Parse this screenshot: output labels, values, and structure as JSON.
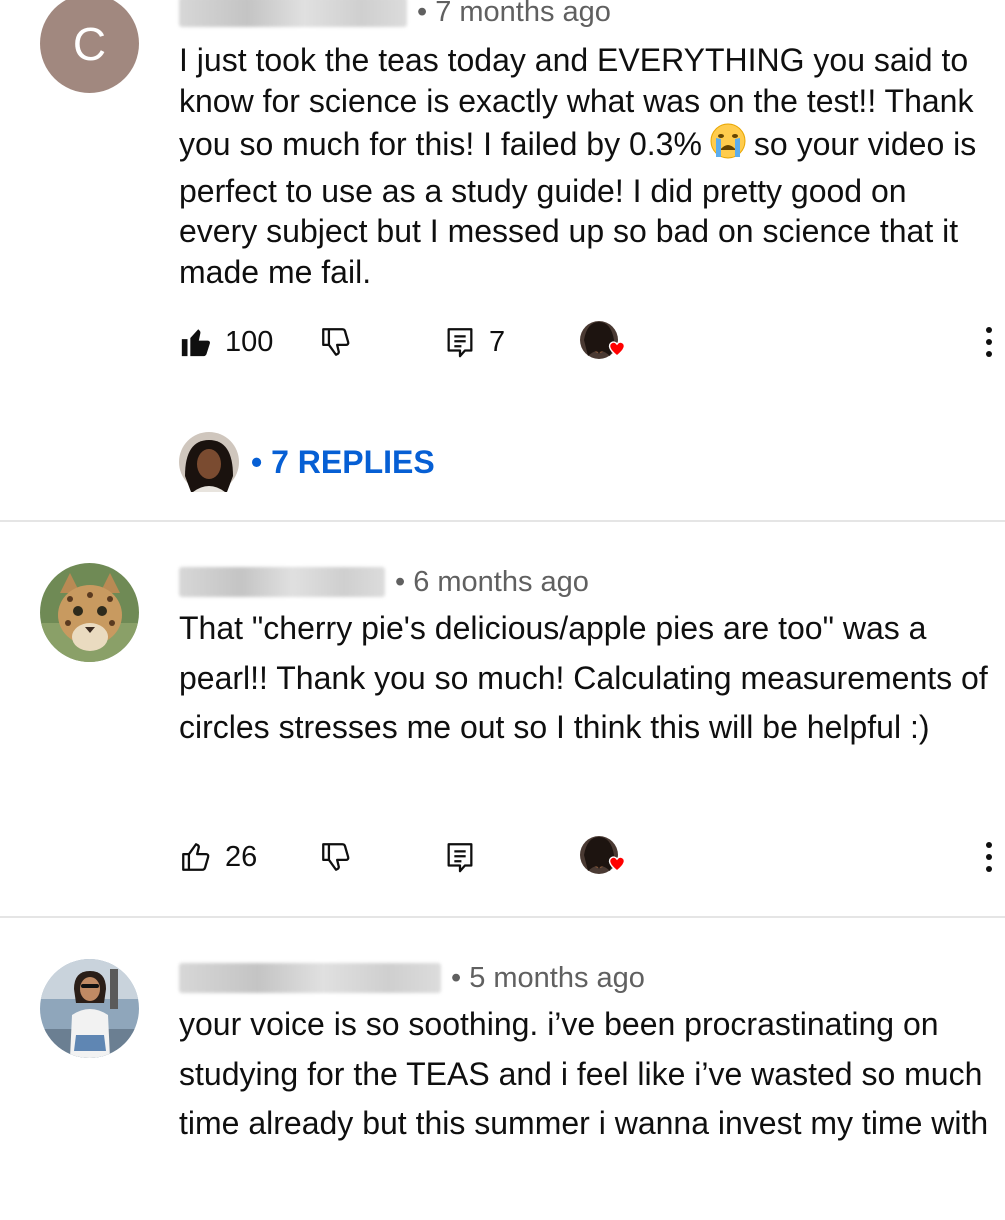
{
  "comments": [
    {
      "avatar_letter": "C",
      "timestamp": "• 7 months ago",
      "text_before_emoji": "I just took the teas today and EVERYTHING you said to know for science is exactly what was on the test!! Thank you so much for this! I failed by 0.3%",
      "emoji": "loudly-crying-face",
      "text_after_emoji": "so your video is perfect to use as a study guide! I did pretty good on every subject but I messed up so bad on science that it made me fail.",
      "likes": "100",
      "liked": true,
      "replies_count": "7",
      "creator_hearted": true,
      "replies_label": "• 7 REPLIES"
    },
    {
      "avatar": "ocelot-photo",
      "timestamp": "• 6 months ago",
      "text": "That \"cherry pie's delicious/apple pies are too\" was a pearl!! Thank you so much! Calculating measurements of circles stresses me out so I think this will be helpful :)",
      "likes": "26",
      "liked": false,
      "creator_hearted": true
    },
    {
      "avatar": "person-photo",
      "timestamp": "• 5 months ago",
      "text": "your voice is so soothing. i’ve been procrastinating on studying for the TEAS and i feel like i’ve wasted so much time already but this summer i wanna invest my time with"
    }
  ],
  "colors": {
    "link_blue": "#065fd4",
    "heart_red": "#ff0000",
    "secondary_text": "#606060",
    "avatar_c_bg": "#a1887f"
  }
}
